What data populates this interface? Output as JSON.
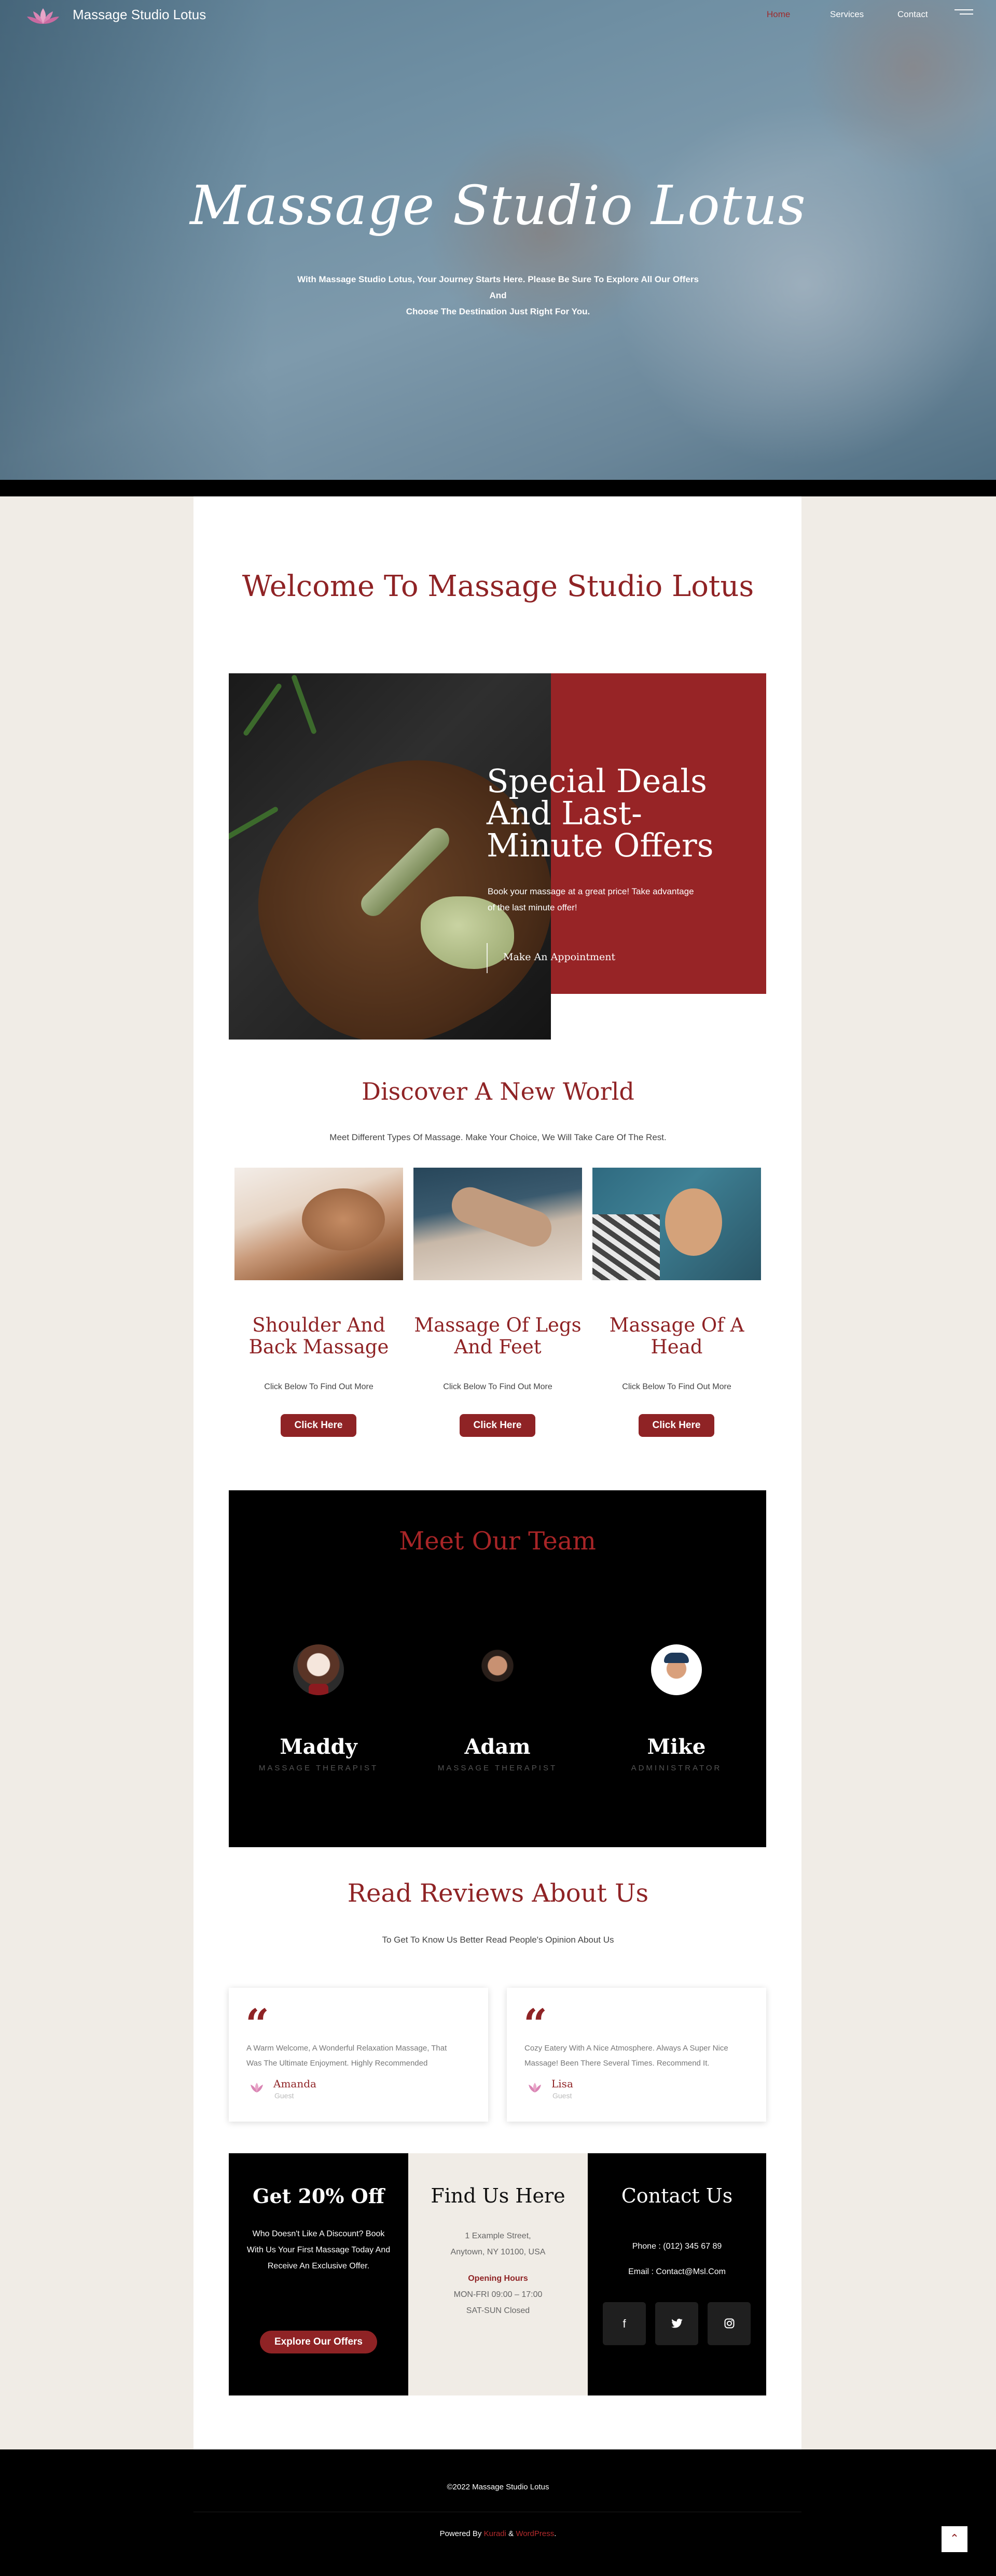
{
  "colors": {
    "accent": "#8f2325",
    "dark": "#000000",
    "hero": "#6f8fa3",
    "page_bg": "#f0ece6"
  },
  "nav": {
    "brand": "Massage Studio Lotus",
    "links": [
      {
        "label": "Home",
        "active": true
      },
      {
        "label": "Services",
        "active": false
      },
      {
        "label": "Contact",
        "active": false
      }
    ],
    "menu_icon": "hamburger-menu-icon",
    "logo_icon": "lotus-icon"
  },
  "hero": {
    "title": "Massage Studio Lotus",
    "subtitle_line1": "With Massage Studio Lotus, Your Journey Starts Here. Please Be Sure To Explore All Our Offers And",
    "subtitle_line2": "Choose The Destination Just Right For You."
  },
  "welcome": {
    "title": "Welcome To Massage Studio Lotus"
  },
  "deals": {
    "title_lines": [
      "Special Deals",
      "And Last-",
      "Minute Offers"
    ],
    "text_line1": "Book your massage at a great price! Take advantage",
    "text_line2": "of the last minute offer!",
    "cta": "Make An Appointment"
  },
  "discover": {
    "title": "Discover A New World",
    "subtitle": "Meet Different Types Of Massage. Make Your Choice, We Will Take Care Of The Rest.",
    "services": [
      {
        "title_line1": "Shoulder And",
        "title_line2": "Back Massage",
        "note": "Click Below To Find Out More",
        "button": "Click Here"
      },
      {
        "title_line1": "Massage Of Legs",
        "title_line2": "And Feet",
        "note": "Click Below To Find Out More",
        "button": "Click Here"
      },
      {
        "title_line1": "Massage Of A",
        "title_line2": "Head",
        "note": "Click Below To Find Out More",
        "button": "Click Here"
      }
    ]
  },
  "team": {
    "title": "Meet Our Team",
    "members": [
      {
        "name": "Maddy",
        "role": "MASSAGE THERAPIST"
      },
      {
        "name": "Adam",
        "role": "MASSAGE THERAPIST"
      },
      {
        "name": "Mike",
        "role": "ADMINISTRATOR"
      }
    ]
  },
  "reviews": {
    "title": "Read Reviews About Us",
    "subtitle": "To Get To Know Us Better Read People's Opinion About Us",
    "items": [
      {
        "text_line1": "A Warm Welcome, A Wonderful Relaxation Massage, That",
        "text_line2": "Was The Ultimate Enjoyment. Highly Recommended",
        "name": "Amanda",
        "role": "Guest"
      },
      {
        "text_line1": "Cozy Eatery With A Nice Atmosphere. Always A Super Nice",
        "text_line2": "Massage! Been There Several Times. Recommend It.",
        "name": "Lisa",
        "role": "Guest"
      }
    ]
  },
  "offer": {
    "title": "Get 20% Off",
    "line1": "Who Doesn't Like A Discount? Book",
    "line2": "With Us Your First Massage Today And",
    "line3": "Receive An Exclusive Offer.",
    "button": "Explore Our Offers"
  },
  "location": {
    "title": "Find Us Here",
    "address1": "1 Example Street,",
    "address2": "Anytown, NY 10100, USA",
    "hours_label": "Opening Hours",
    "hours1": "MON-FRI 09:00 – 17:00",
    "hours2": "SAT-SUN Closed"
  },
  "contact": {
    "title": "Contact Us",
    "phone": "Phone : (012) 345 67 89",
    "email": "Email : Contact@Msl.Com",
    "socials": [
      "facebook-icon",
      "twitter-icon",
      "instagram-icon"
    ]
  },
  "footer": {
    "copyright": "©2022 Massage Studio Lotus",
    "powered_prefix": "Powered By",
    "powered_link1": "Kuradi",
    "powered_amp": "&",
    "powered_link2": "WordPress",
    "powered_suffix": "."
  }
}
